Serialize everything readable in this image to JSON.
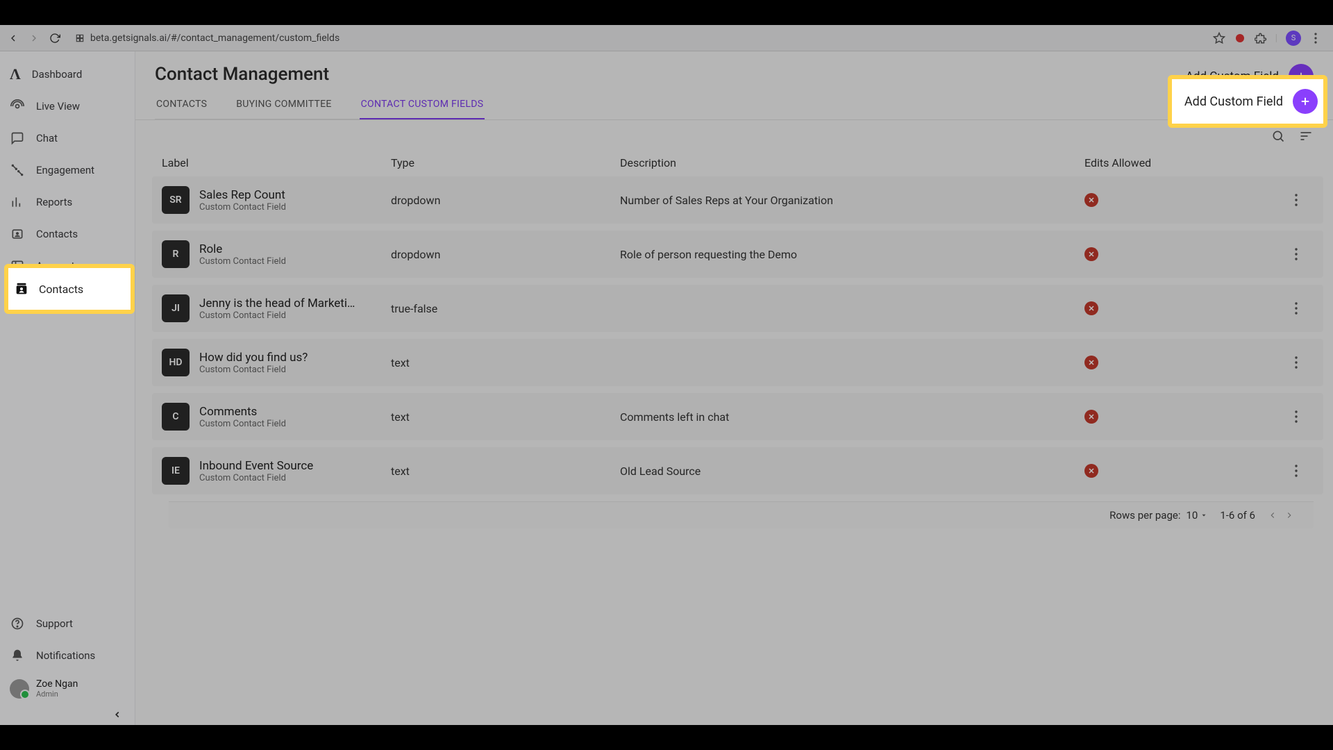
{
  "browser": {
    "url": "beta.getsignals.ai/#/contact_management/custom_fields",
    "avatar_initial": "S"
  },
  "sidebar": {
    "items": [
      {
        "label": "Dashboard"
      },
      {
        "label": "Live View"
      },
      {
        "label": "Chat"
      },
      {
        "label": "Engagement"
      },
      {
        "label": "Reports"
      },
      {
        "label": "Contacts"
      },
      {
        "label": "Accounts"
      }
    ],
    "support": "Support",
    "notifications": "Notifications",
    "user": {
      "name": "Zoe Ngan",
      "role": "Admin"
    }
  },
  "header": {
    "title": "Contact Management",
    "add_label": "Add Custom Field",
    "tabs": [
      {
        "label": "CONTACTS"
      },
      {
        "label": "BUYING COMMITTEE"
      },
      {
        "label": "CONTACT CUSTOM FIELDS"
      }
    ]
  },
  "columns": {
    "label": "Label",
    "type": "Type",
    "description": "Description",
    "edits": "Edits Allowed"
  },
  "rows": [
    {
      "badge": "SR",
      "label": "Sales Rep Count",
      "sub": "Custom Contact Field",
      "type": "dropdown",
      "desc": "Number of Sales Reps at Your Organization"
    },
    {
      "badge": "R",
      "label": "Role",
      "sub": "Custom Contact Field",
      "type": "dropdown",
      "desc": "Role of person requesting the Demo"
    },
    {
      "badge": "JI",
      "label": "Jenny is the head of Marketi…",
      "sub": "Custom Contact Field",
      "type": "true-false",
      "desc": ""
    },
    {
      "badge": "HD",
      "label": "How did you find us?",
      "sub": "Custom Contact Field",
      "type": "text",
      "desc": ""
    },
    {
      "badge": "C",
      "label": "Comments",
      "sub": "Custom Contact Field",
      "type": "text",
      "desc": "Comments left in chat"
    },
    {
      "badge": "IE",
      "label": "Inbound Event Source",
      "sub": "Custom Contact Field",
      "type": "text",
      "desc": "Old Lead Source"
    }
  ],
  "pager": {
    "rpp_label": "Rows per page:",
    "rpp_value": "10",
    "range": "1-6 of 6"
  },
  "highlight": {
    "contacts": "Contacts",
    "add": "Add Custom Field"
  }
}
